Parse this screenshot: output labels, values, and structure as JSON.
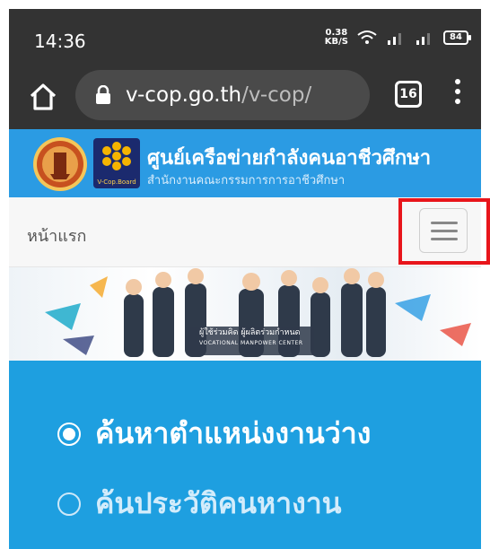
{
  "status_bar": {
    "time": "14:36",
    "net_speed_value": "0.38",
    "net_speed_unit": "KB/S",
    "battery": "84"
  },
  "browser": {
    "url_domain": "v-cop.go.th",
    "url_path": "/v-cop/",
    "tab_count": "16"
  },
  "site": {
    "title": "ศูนย์เครือข่ายกำลังคนอาชีวศึกษา",
    "subtitle": "สำนักงานคณะกรรมการการอาชีวศึกษา",
    "vcop_logo_text": "V-Cop.Board"
  },
  "nav": {
    "home_label": "หน้าแรก"
  },
  "banner": {
    "caption_th": "ผู้ใช้ร่วมคิด ผู้ผลิตร่วมกำหนด",
    "caption_en": "VOCATIONAL MANPOWER CENTER"
  },
  "search_options": [
    {
      "label": "ค้นหาตำแหน่งงานว่าง",
      "selected": true
    },
    {
      "label": "ค้นประวัติคนหางาน",
      "selected": false
    }
  ],
  "colors": {
    "browser_chrome": "#333333",
    "header_blue": "#2b9be3",
    "panel_blue": "#1e9fe0",
    "highlight_red": "#e8151b"
  }
}
